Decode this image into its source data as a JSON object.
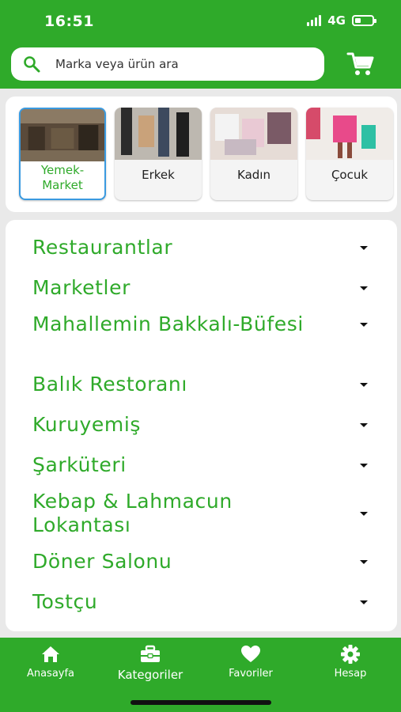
{
  "status_bar": {
    "time": "16:51",
    "network": "4G"
  },
  "search": {
    "placeholder": "Marka veya ürün ara",
    "icon": "search-icon"
  },
  "header": {
    "cart_icon": "shopping-cart-icon"
  },
  "colors": {
    "brand_green": "#2faa2a",
    "selected_border": "#3a9ae0",
    "background": "#e9e9e9"
  },
  "categories": [
    {
      "label": "Yemek-\nMarket",
      "selected": true
    },
    {
      "label": "Erkek",
      "selected": false
    },
    {
      "label": "Kadın",
      "selected": false
    },
    {
      "label": "Çocuk",
      "selected": false
    }
  ],
  "sections": [
    {
      "label": "Restaurantlar"
    },
    {
      "label": "Marketler"
    },
    {
      "label": "Mahallemin Bakkalı-Büfesi"
    },
    {
      "label": "Balık Restoranı"
    },
    {
      "label": "Kuruyemiş"
    },
    {
      "label": "Şarküteri"
    },
    {
      "label": "Kebap & Lahmacun Lokantası"
    },
    {
      "label": "Döner Salonu"
    },
    {
      "label": "Tostçu"
    }
  ],
  "tabbar": {
    "items": [
      {
        "label": "Anasayfa",
        "icon": "home-icon"
      },
      {
        "label": "Kategoriler",
        "icon": "briefcase-icon",
        "active": true
      },
      {
        "label": "Favoriler",
        "icon": "heart-icon"
      },
      {
        "label": "Hesap",
        "icon": "gear-icon"
      }
    ]
  }
}
